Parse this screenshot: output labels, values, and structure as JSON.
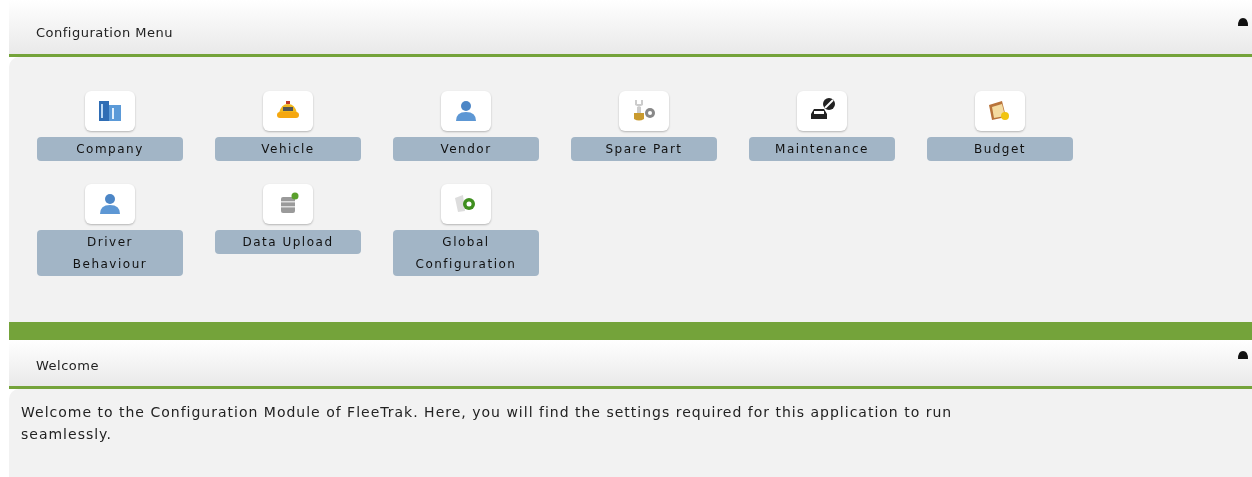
{
  "config_panel": {
    "title": "Configuration Menu",
    "items": [
      {
        "label": "Company"
      },
      {
        "label": "Vehicle"
      },
      {
        "label": "Vendor"
      },
      {
        "label": "Spare Part"
      },
      {
        "label": "Maintenance"
      },
      {
        "label": "Budget"
      },
      {
        "label": "Driver Behaviour"
      },
      {
        "label": "Data Upload"
      },
      {
        "label": "Global Configuration"
      }
    ]
  },
  "welcome_panel": {
    "title": "Welcome",
    "text": "Welcome to the Configuration Module of FleeTrak. Here, you will find the settings required for this application to run seamlessly."
  }
}
